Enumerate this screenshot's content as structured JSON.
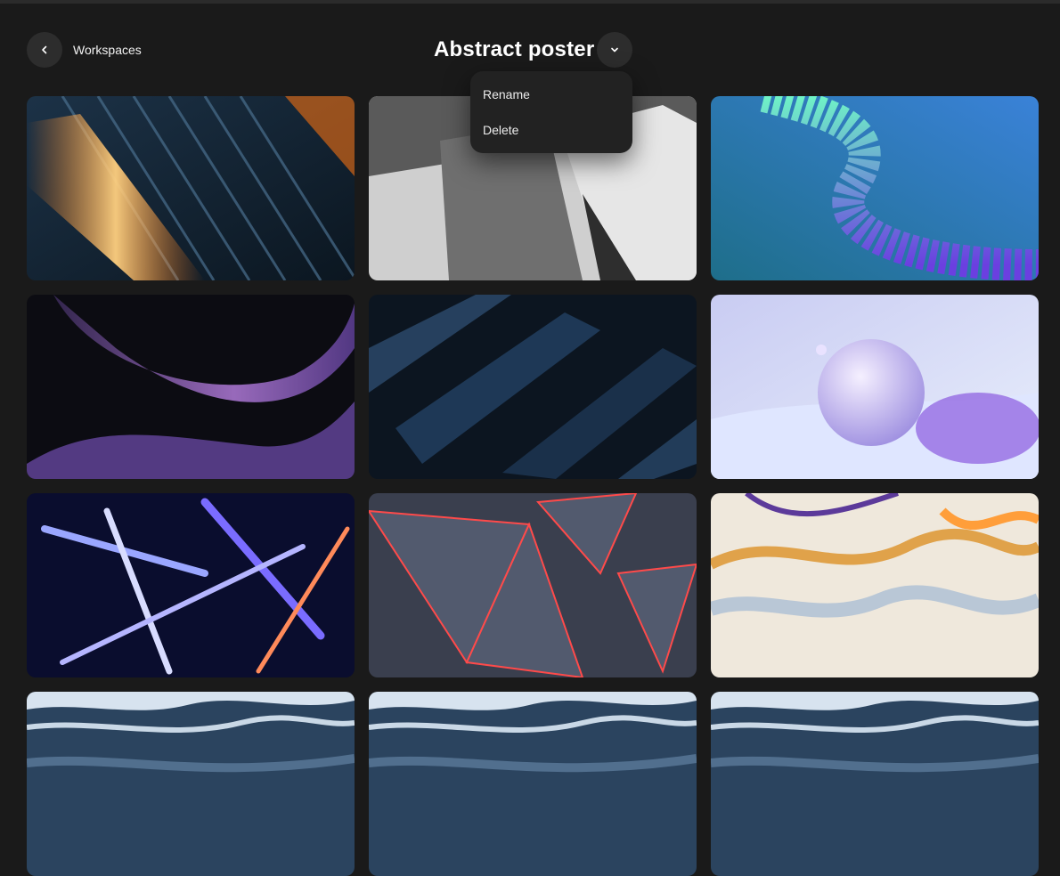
{
  "header": {
    "back_label": "Workspaces",
    "title": "Abstract poster"
  },
  "menu": {
    "items": [
      "Rename",
      "Delete"
    ]
  },
  "gallery": {
    "images": [
      "orange-blue-light-streaks",
      "gray-paper-shapes",
      "teal-green-3d-spiral",
      "purple-black-wave",
      "dark-blue-wood",
      "pastel-sphere-3d",
      "neon-blue-tubes",
      "red-glowing-triangles",
      "marbled-oil-swirl",
      "blue-ocean-waves",
      "blue-ocean-waves",
      "blue-ocean-waves"
    ]
  },
  "colors": {
    "background": "#1a1a1a",
    "button": "#2d2d2d",
    "menu": "#222222"
  },
  "icons": {
    "back": "chevron-left-icon",
    "title_menu": "chevron-down-icon"
  }
}
